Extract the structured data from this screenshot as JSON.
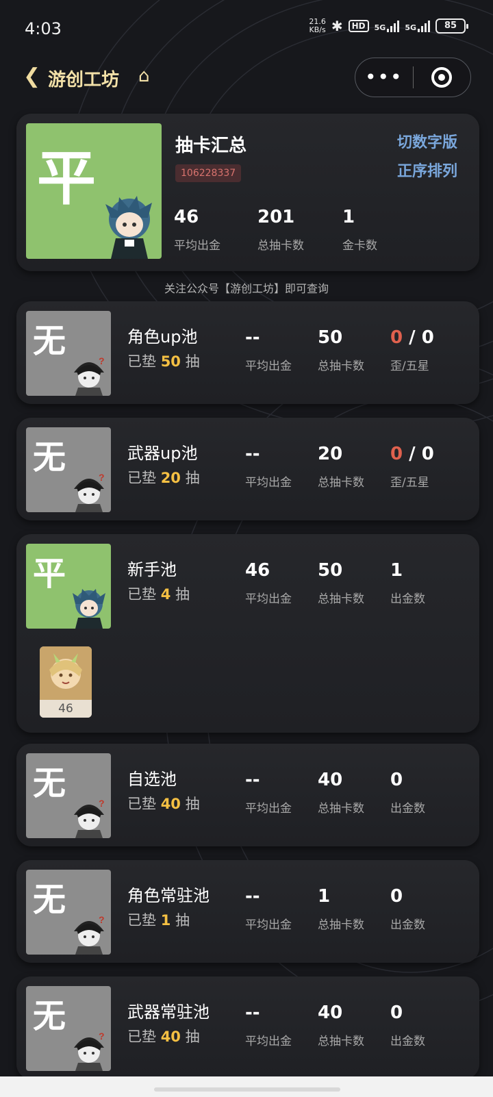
{
  "status_bar": {
    "time": "4:03",
    "net_speed_value": "21.6",
    "net_speed_unit": "KB/s",
    "hd_label": "HD",
    "signal1": "5G",
    "signal2": "5G",
    "battery": "85"
  },
  "nav": {
    "back_icon": "chevron-left-icon",
    "title": "游创工坊",
    "home_icon": "home-icon",
    "more_label": "•••"
  },
  "summary": {
    "avatar_char": "平",
    "title": "抽卡汇总",
    "uid": "106228337",
    "switch_label": "切数字版",
    "order_label": "正序排列",
    "stats": [
      {
        "value": "46",
        "label": "平均出金"
      },
      {
        "value": "201",
        "label": "总抽卡数"
      },
      {
        "value": "1",
        "label": "金卡数"
      }
    ]
  },
  "tip": "关注公众号【游创工坊】即可查询",
  "pools": [
    {
      "avatar_char": "无",
      "name": "角色up池",
      "pad_prefix": "已垫",
      "pad_value": "50",
      "pad_suffix": "抽",
      "avg_value": "--",
      "avg_label": "平均出金",
      "total_value": "50",
      "total_label": "总抽卡数",
      "third_red": "0",
      "third_sep": " / ",
      "third_value": "0",
      "third_label": "歪/五星"
    },
    {
      "avatar_char": "无",
      "name": "武器up池",
      "pad_prefix": "已垫",
      "pad_value": "20",
      "pad_suffix": "抽",
      "avg_value": "--",
      "avg_label": "平均出金",
      "total_value": "20",
      "total_label": "总抽卡数",
      "third_red": "0",
      "third_sep": " / ",
      "third_value": "0",
      "third_label": "歪/五星"
    },
    {
      "avatar_char": "平",
      "name": "新手池",
      "pad_prefix": "已垫",
      "pad_value": "4",
      "pad_suffix": "抽",
      "avg_value": "46",
      "avg_label": "平均出金",
      "total_value": "50",
      "total_label": "总抽卡数",
      "third_value": "1",
      "third_label": "出金数",
      "item_count": "46"
    },
    {
      "avatar_char": "无",
      "name": "自选池",
      "pad_prefix": "已垫",
      "pad_value": "40",
      "pad_suffix": "抽",
      "avg_value": "--",
      "avg_label": "平均出金",
      "total_value": "40",
      "total_label": "总抽卡数",
      "third_value": "0",
      "third_label": "出金数"
    },
    {
      "avatar_char": "无",
      "name": "角色常驻池",
      "pad_prefix": "已垫",
      "pad_value": "1",
      "pad_suffix": "抽",
      "avg_value": "--",
      "avg_label": "平均出金",
      "total_value": "1",
      "total_label": "总抽卡数",
      "third_value": "0",
      "third_label": "出金数"
    },
    {
      "avatar_char": "无",
      "name": "武器常驻池",
      "pad_prefix": "已垫",
      "pad_value": "40",
      "pad_suffix": "抽",
      "avg_value": "--",
      "avg_label": "平均出金",
      "total_value": "40",
      "total_label": "总抽卡数",
      "third_value": "0",
      "third_label": "出金数"
    }
  ],
  "colors": {
    "accent_gold": "#f5c043",
    "link_blue": "#7aa7dc",
    "red": "#e0614e",
    "lucky_green": "#8fc26e",
    "none_gray": "#8d8d8d"
  }
}
